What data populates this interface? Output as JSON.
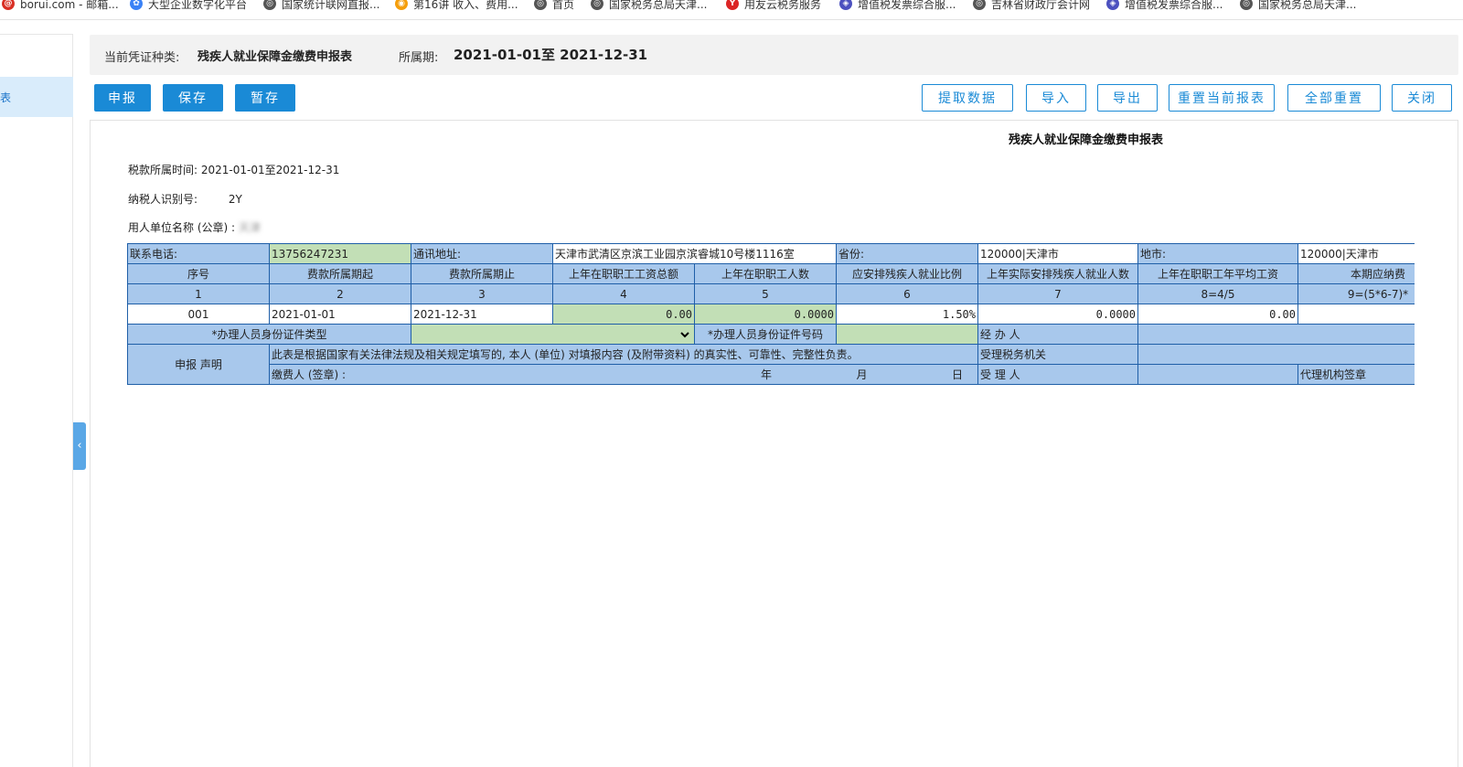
{
  "bookmarks": [
    {
      "icon": "mail-icon",
      "label": "borui.com - 邮箱...",
      "color": "#d93025",
      "glyph": "@"
    },
    {
      "icon": "pinwheel-icon",
      "label": "大型企业数字化平台",
      "color": "#3b82f6",
      "glyph": "✿"
    },
    {
      "icon": "globe-icon",
      "label": "国家统计联网直报...",
      "color": "#555555",
      "glyph": "◎"
    },
    {
      "icon": "orange-logo-icon",
      "label": "第16讲 收入、费用...",
      "color": "#f59e0b",
      "glyph": "◉"
    },
    {
      "icon": "globe-icon",
      "label": "首页",
      "color": "#555555",
      "glyph": "◎"
    },
    {
      "icon": "globe-icon",
      "label": "国家税务总局天津...",
      "color": "#555555",
      "glyph": "◎"
    },
    {
      "icon": "yonyou-logo-icon",
      "label": "用友云税务服务",
      "color": "#dc2626",
      "glyph": "Y"
    },
    {
      "icon": "tax-logo-icon",
      "label": "增值税发票综合服...",
      "color": "#4c51bf",
      "glyph": "◈"
    },
    {
      "icon": "globe-icon",
      "label": "吉林省财政厅会计网",
      "color": "#555555",
      "glyph": "◎"
    },
    {
      "icon": "tax-logo-icon",
      "label": "增值税发票综合服...",
      "color": "#4c51bf",
      "glyph": "◈"
    },
    {
      "icon": "globe-icon",
      "label": "国家税务总局天津...",
      "color": "#555555",
      "glyph": "◎"
    }
  ],
  "sidebar": {
    "active_label": "表"
  },
  "voucher": {
    "type_label": "当前凭证种类:",
    "type_value": "残疾人就业保障金缴费申报表",
    "period_label": "所属期:",
    "period_value": "2021-01-01至 2021-12-31"
  },
  "toolbar": {
    "left": [
      "申报",
      "保存",
      "暂存"
    ],
    "right": [
      "提取数据",
      "导入",
      "导出",
      "重置当前报表",
      "全部重置",
      "关闭"
    ]
  },
  "form": {
    "title": "残疾人就业保障金缴费申报表",
    "tax_period": "税款所属时间: 2021-01-01至2021-12-31",
    "taxpayer_id_label": "纳税人识别号:",
    "taxpayer_id_value": "2Y",
    "employer_label": "用人单位名称 (公章) :",
    "employer_value": "天津",
    "phone_label": "联系电话:",
    "phone_value": "13756247231",
    "address_label": "通讯地址:",
    "address_value": "天津市武清区京滨工业园京滨睿城10号楼1116室",
    "province_label": "省份:",
    "province_value": "120000|天津市",
    "city_label": "地市:",
    "city_value": "120000|天津市",
    "headers": [
      "序号",
      "费款所属期起",
      "费款所属期止",
      "上年在职职工工资总额",
      "上年在职职工人数",
      "应安排残疾人就业比例",
      "上年实际安排残疾人就业人数",
      "上年在职职工年平均工资",
      "本期应纳费"
    ],
    "indices": [
      "1",
      "2",
      "3",
      "4",
      "5",
      "6",
      "7",
      "8=4/5",
      "9=(5*6-7)*"
    ],
    "row": [
      "001",
      "2021-01-01",
      "2021-12-31",
      "0.00",
      "0.0000",
      "1.50%",
      "0.0000",
      "0.00",
      ""
    ],
    "handler_idtype_label": "*办理人员身份证件类型",
    "handler_idno_label": "*办理人员身份证件号码",
    "agent_label": "经 办 人",
    "declaration_label": "申报 声明",
    "declaration_text": "此表是根据国家有关法律法规及相关规定填写的, 本人 (单位) 对填报内容 (及附带资料) 的真实性、可靠性、完整性负责。",
    "tax_office_label": "受理税务机关",
    "payer_sign_label": "缴费人 (签章) :",
    "year_label": "年",
    "month_label": "月",
    "day_label": "日",
    "receiver_label": "受 理 人",
    "agency_seal_label": "代理机构签章"
  }
}
